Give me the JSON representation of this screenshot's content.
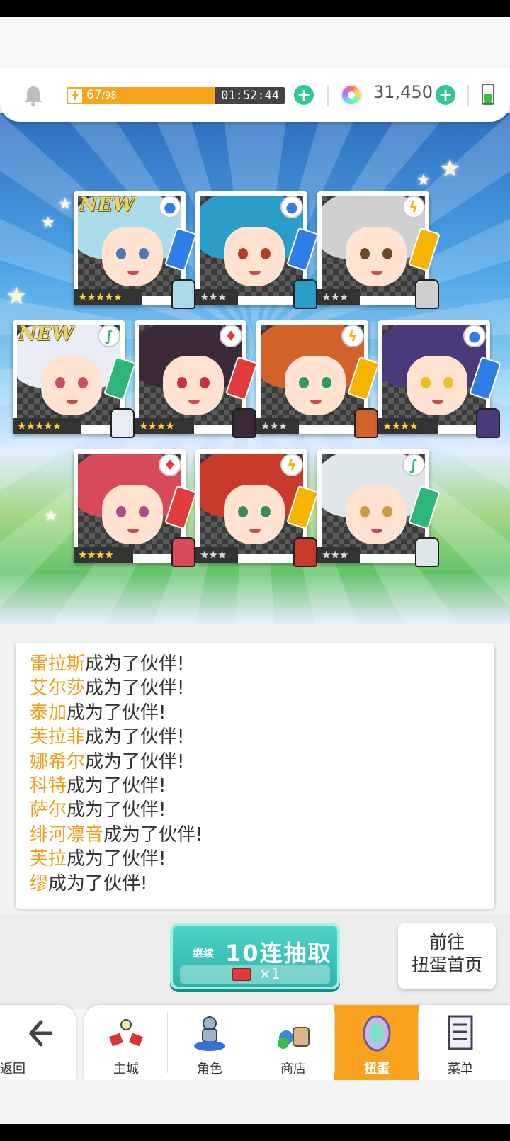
{
  "status_bar": {
    "stamina_current": "67",
    "stamina_max": "/98",
    "stamina_fraction": 0.68,
    "timer": "01:52:44",
    "gem_count": "31,450"
  },
  "cards": [
    {
      "name_id": "card-1",
      "is_new": true,
      "new_label": "NEW",
      "element": "water",
      "element_icon": "water-element-icon",
      "stars": "★★★★★",
      "rarity": 5,
      "hair": "#a9dbe8",
      "eye": "#4a78b8"
    },
    {
      "name_id": "card-2",
      "is_new": false,
      "element": "water",
      "element_icon": "water-element-icon",
      "stars": "★★★",
      "rarity": 3,
      "hair": "#2a9ec9",
      "eye": "#b83a2a"
    },
    {
      "name_id": "card-3",
      "is_new": false,
      "element": "thunder",
      "element_icon": "thunder-element-icon",
      "stars": "★★★",
      "rarity": 3,
      "hair": "#cfcfcf",
      "eye": "#6a4a2a"
    },
    {
      "name_id": "card-4",
      "is_new": true,
      "new_label": "NEW",
      "element": "wind",
      "element_icon": "wind-element-icon",
      "stars": "★★★★★",
      "rarity": 5,
      "hair": "#e9ecf6",
      "eye": "#d14a6a"
    },
    {
      "name_id": "card-5",
      "is_new": false,
      "element": "fire",
      "element_icon": "fire-element-icon",
      "stars": "★★★★",
      "rarity": 4,
      "hair": "#3a2a3a",
      "eye": "#c8304a"
    },
    {
      "name_id": "card-6",
      "is_new": false,
      "element": "thunder",
      "element_icon": "thunder-element-icon",
      "stars": "★★★",
      "rarity": 3,
      "hair": "#d2612a",
      "eye": "#2a9a6a"
    },
    {
      "name_id": "card-7",
      "is_new": false,
      "element": "water",
      "element_icon": "water-element-icon",
      "stars": "★★★★",
      "rarity": 4,
      "hair": "#4a3a7a",
      "eye": "#e8c020"
    },
    {
      "name_id": "card-8",
      "is_new": false,
      "element": "fire",
      "element_icon": "fire-element-icon",
      "stars": "★★★★",
      "rarity": 4,
      "hair": "#d84a5a",
      "eye": "#b04a8a"
    },
    {
      "name_id": "card-9",
      "is_new": false,
      "element": "thunder",
      "element_icon": "thunder-element-icon",
      "stars": "★★★",
      "rarity": 3,
      "hair": "#c83a2a",
      "eye": "#3a8a5a"
    },
    {
      "name_id": "card-10",
      "is_new": false,
      "element": "wind",
      "element_icon": "wind-element-icon",
      "stars": "★★★",
      "rarity": 3,
      "hair": "#dfe6ea",
      "eye": "#c8a040"
    }
  ],
  "messages": [
    {
      "name": "雷拉斯",
      "text": "成为了伙伴!"
    },
    {
      "name": "艾尔莎",
      "text": "成为了伙伴!"
    },
    {
      "name": "泰加",
      "text": "成为了伙伴!"
    },
    {
      "name": "芙拉菲",
      "text": "成为了伙伴!"
    },
    {
      "name": "娜希尔",
      "text": "成为了伙伴!"
    },
    {
      "name": "科特",
      "text": "成为了伙伴!"
    },
    {
      "name": "萨尔",
      "text": "成为了伙伴!"
    },
    {
      "name": "绯河凛音",
      "text": "成为了伙伴!"
    },
    {
      "name": "芙拉",
      "text": "成为了伙伴!"
    },
    {
      "name": "缪",
      "text": "成为了伙伴!"
    }
  ],
  "pull_button": {
    "sub_label": "继续",
    "main_label": "10连抽取",
    "ticket_count": "×1"
  },
  "goto_button": {
    "line1": "前往",
    "line2": "扭蛋首页"
  },
  "nav": {
    "back_label": "返回",
    "items": [
      {
        "label": "主城",
        "icon": "castle-icon",
        "active": false
      },
      {
        "label": "角色",
        "icon": "character-icon",
        "active": false
      },
      {
        "label": "商店",
        "icon": "shop-icon",
        "active": false
      },
      {
        "label": "扭蛋",
        "icon": "gacha-icon",
        "active": true
      },
      {
        "label": "菜单",
        "icon": "menu-icon",
        "active": false
      }
    ]
  },
  "colors": {
    "accent_orange": "#f8a21e",
    "name_orange": "#f29d1c",
    "teal": "#2eb5ab",
    "plus_green": "#2fc69a"
  }
}
